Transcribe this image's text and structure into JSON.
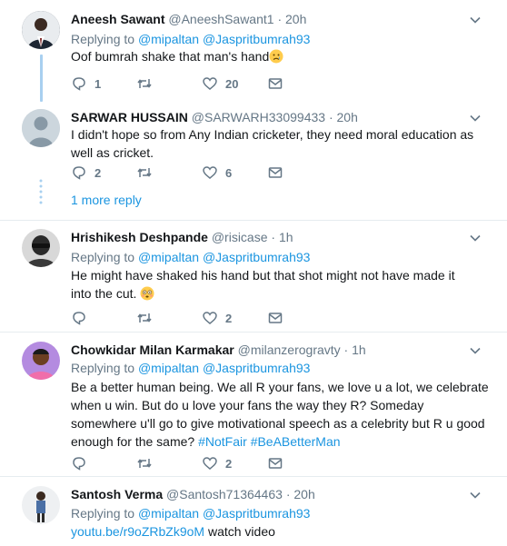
{
  "tweets": [
    {
      "name": "Aneesh Sawant",
      "handle": "@AneeshSawant1",
      "time": "20h",
      "replying_prefix": "Replying to",
      "reply_to": [
        "@mipaltan",
        "@Jaspritbumrah93"
      ],
      "text": "Oof bumrah shake that man's hand",
      "emoji": "crying-face",
      "replies": "1",
      "retweets": "",
      "likes": "20"
    },
    {
      "name": "SARWAR HUSSAIN",
      "handle": "@SARWARH33099433",
      "time": "20h",
      "text": "I didn't hope so from Any Indian cricketer, they need moral education as well as cricket.",
      "replies": "2",
      "retweets": "",
      "likes": "6"
    },
    {
      "name": "Hrishikesh Deshpande",
      "handle": "@risicase",
      "time": "1h",
      "replying_prefix": "Replying to",
      "reply_to": [
        "@mipaltan",
        "@Jaspritbumrah93"
      ],
      "text": "He might have shaked his hand but that shot might not have made it into the cut.",
      "emoji": "flushed-face",
      "replies": "",
      "retweets": "",
      "likes": "2"
    },
    {
      "name": "Chowkidar Milan Karmakar",
      "handle": "@milanzerogravty",
      "time": "1h",
      "replying_prefix": "Replying to",
      "reply_to": [
        "@mipaltan",
        "@Jaspritbumrah93"
      ],
      "text": "Be a better human being. We all R your fans, we love u a lot, we celebrate when u win. But do u love your fans the way they R? Someday somewhere u'll go to give motivational speech as a celebrity but R u good enough for the same?",
      "hashtags": [
        "#NotFair",
        "#BeABetterMan"
      ],
      "replies": "",
      "retweets": "",
      "likes": "2"
    },
    {
      "name": "Santosh Verma",
      "handle": "@Santosh71364463",
      "time": "20h",
      "replying_prefix": "Replying to",
      "reply_to": [
        "@mipaltan",
        "@Jaspritbumrah93"
      ],
      "link": "youtu.be/r9oZRbZk9oM",
      "text_after_link": "watch video"
    }
  ],
  "more_replies_label": "1 more reply",
  "dot": "·",
  "colors": {
    "link": "#1b95e0",
    "muted": "#657786",
    "thread_line": "#a8d0f0",
    "divider": "#e6ecf0"
  }
}
